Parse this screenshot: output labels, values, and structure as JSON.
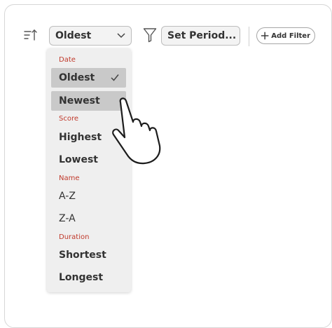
{
  "toolbar": {
    "sort_value": "Oldest",
    "period_value": "Set Period...",
    "add_filter_label": "Add Filter"
  },
  "dropdown": {
    "sections": [
      {
        "label": "Date",
        "options": [
          "Oldest",
          "Newest"
        ]
      },
      {
        "label": "Score",
        "options": [
          "Highest",
          "Lowest"
        ]
      },
      {
        "label": "Name",
        "options": [
          "A-Z",
          "Z-A"
        ]
      },
      {
        "label": "Duration",
        "options": [
          "Shortest",
          "Longest"
        ]
      }
    ],
    "selected": "Oldest",
    "hovered": "Newest"
  },
  "icons": [
    "sort-icon",
    "chevron-down-icon",
    "filter-icon",
    "plus-icon",
    "check-icon",
    "pointer-hand-icon"
  ],
  "colors": {
    "section_label": "#c0392b",
    "highlight": "#c9c9c9",
    "menu_bg": "#efefef"
  }
}
